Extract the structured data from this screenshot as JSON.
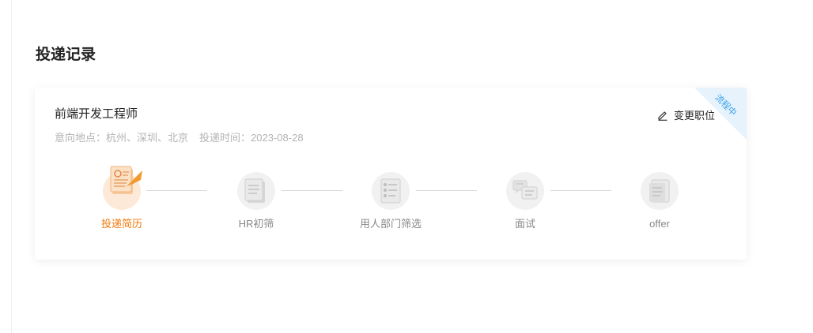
{
  "page": {
    "title": "投递记录"
  },
  "application": {
    "job_title": "前端开发工程师",
    "status_ribbon": "流程中",
    "change_button_label": "变更职位",
    "location_label": "意向地点：",
    "locations": "杭州、深圳、北京",
    "time_label": "投递时间：",
    "submit_time": "2023-08-28"
  },
  "steps": [
    {
      "label": "投递简历",
      "icon": "resume-submit-icon",
      "active": true
    },
    {
      "label": "HR初筛",
      "icon": "document-icon",
      "active": false
    },
    {
      "label": "用人部门筛选",
      "icon": "checklist-icon",
      "active": false
    },
    {
      "label": "面试",
      "icon": "interview-icon",
      "active": false
    },
    {
      "label": "offer",
      "icon": "offer-icon",
      "active": false
    }
  ],
  "colors": {
    "accent": "#f0780a",
    "ribbon_text": "#3aa0ea",
    "ribbon_bg": "#e6f3fd",
    "muted": "#b3b3b3"
  }
}
